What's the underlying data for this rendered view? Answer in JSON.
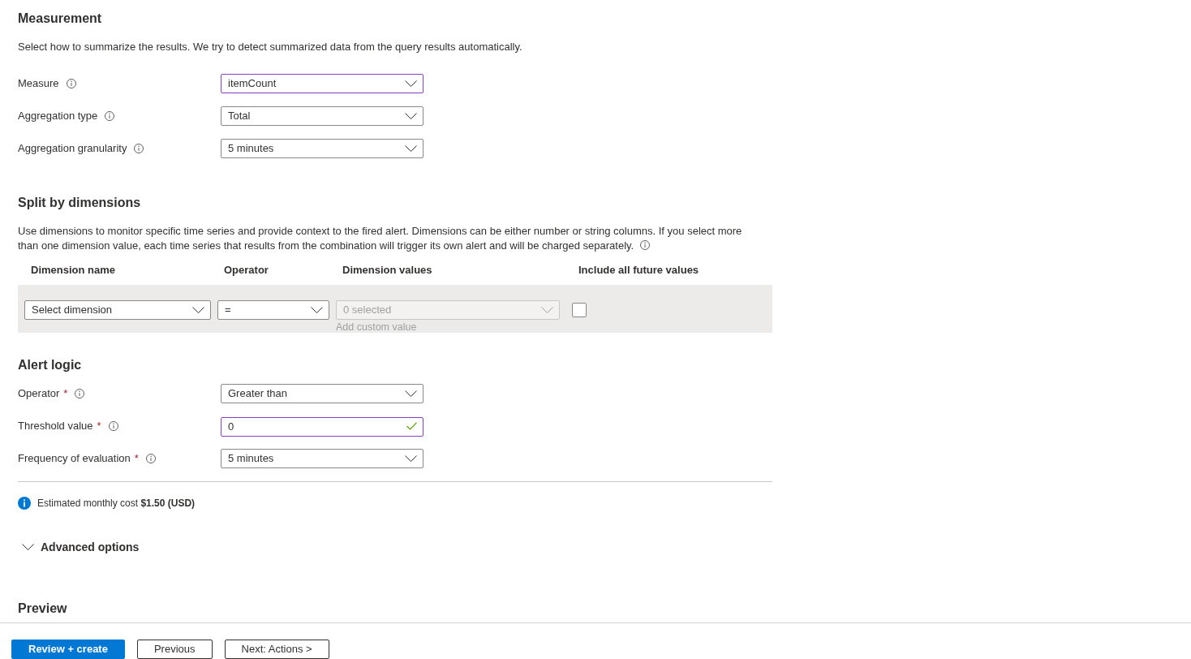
{
  "measurement": {
    "title": "Measurement",
    "description": "Select how to summarize the results. We try to detect summarized data from the query results automatically.",
    "fields": [
      {
        "label": "Measure",
        "info": true,
        "kind": "select",
        "value": "itemCount",
        "focused": true
      },
      {
        "label": "Aggregation type",
        "info": true,
        "kind": "select",
        "value": "Total",
        "focused": false
      },
      {
        "label": "Aggregation granularity",
        "info": true,
        "kind": "select",
        "value": "5 minutes",
        "focused": false
      }
    ]
  },
  "split_by_dimensions": {
    "title": "Split by dimensions",
    "description": "Use dimensions to monitor specific time series and provide context to the fired alert. Dimensions can be either number or string columns. If you select more than one dimension value, each time series that results from the combination will trigger its own alert and will be charged separately.",
    "description_info": true,
    "columns": [
      "Dimension name",
      "Operator",
      "Dimension values",
      "Include all future values"
    ],
    "rows": [
      {
        "dimension_name": {
          "placeholder": "Select dimension",
          "disabled": false
        },
        "operator": {
          "value": "=",
          "disabled": false
        },
        "dimension_values": {
          "value": "0 selected",
          "disabled": true,
          "link": "Add custom value"
        },
        "include_all_future_values": {
          "checked": false
        }
      }
    ]
  },
  "alert_logic": {
    "title": "Alert logic",
    "fields": [
      {
        "label": "Operator",
        "required_mark": "*",
        "info": true,
        "kind": "select",
        "value": "Greater than",
        "focused": false
      },
      {
        "label": "Threshold value",
        "required_mark": "*",
        "info": true,
        "kind": "text",
        "value": "0",
        "focused": true,
        "valid": true
      },
      {
        "label": "Frequency of evaluation",
        "required_mark": "*",
        "info": true,
        "kind": "select",
        "value": "5 minutes",
        "focused": false
      }
    ]
  },
  "cost_notice": {
    "text": "Estimated monthly cost **$1.50 (USD)**"
  },
  "advanced_options": {
    "label": "Advanced options",
    "expanded": false
  },
  "preview": {
    "title": "Preview"
  },
  "footer": {
    "buttons": [
      {
        "label": "Review + create",
        "kind": "primary"
      },
      {
        "label": "Previous",
        "kind": "default"
      },
      {
        "label": "Next: Actions >",
        "kind": "default"
      }
    ]
  }
}
